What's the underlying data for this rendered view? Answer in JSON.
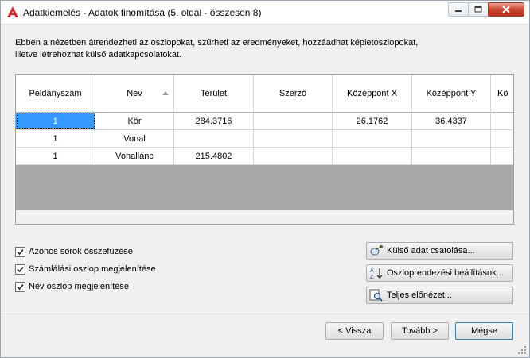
{
  "window": {
    "title": "Adatkiemelés - Adatok finomítása (5. oldal - összesen 8)",
    "app_icon": "autocad-icon",
    "controls": [
      "minimize-icon",
      "maximize-icon",
      "close-icon"
    ]
  },
  "intro": {
    "line1": "Ebben a nézetben átrendezheti az oszlopokat, szűrheti az eredményeket, hozzáadhat képletoszlopokat,",
    "line2": "illetve létrehozhat külső adatkapcsolatokat."
  },
  "grid": {
    "columns": [
      "Példányszám",
      "Név",
      "Terület",
      "Szerző",
      "Középpont X",
      "Középpont Y",
      "Kö"
    ],
    "sorted_column": "Név",
    "rows": [
      [
        "1",
        "Kör",
        "284.3716",
        "",
        "26.1762",
        "36.4337",
        ""
      ],
      [
        "1",
        "Vonal",
        "",
        "",
        "",
        "",
        ""
      ],
      [
        "1",
        "Vonallánc",
        "215.4802",
        "",
        "",
        "",
        ""
      ]
    ],
    "selected_row": 0
  },
  "options": {
    "combine_rows": "Azonos sorok összefűzése",
    "show_count": "Számlálási oszlop megjelenítése",
    "show_name": "Név oszlop megjelenítése"
  },
  "actions": {
    "link_external": "Külső adat csatolása...",
    "sort_settings": "Oszloprendezési beállítások...",
    "full_preview": "Teljes előnézet..."
  },
  "nav": {
    "back": "< Vissza",
    "next": "Tovább >",
    "cancel": "Mégse"
  },
  "colors": {
    "selection": "#3399ff",
    "grid_background": "#a8a8a8",
    "close_button": "#c9452f"
  }
}
